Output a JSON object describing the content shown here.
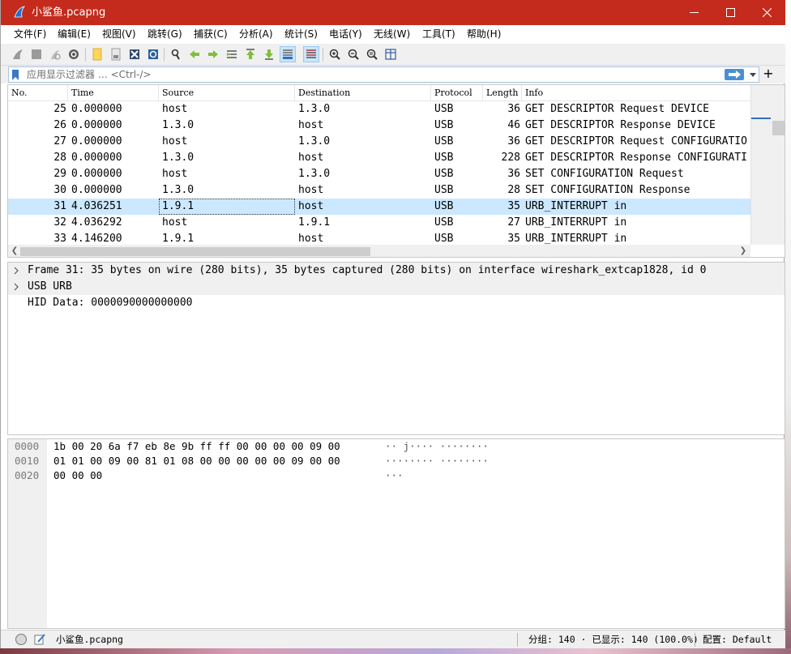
{
  "window": {
    "title": "小鲨鱼.pcapng"
  },
  "menu": [
    {
      "label": "文件(F)"
    },
    {
      "label": "编辑(E)"
    },
    {
      "label": "视图(V)"
    },
    {
      "label": "跳转(G)"
    },
    {
      "label": "捕获(C)"
    },
    {
      "label": "分析(A)"
    },
    {
      "label": "统计(S)"
    },
    {
      "label": "电话(Y)"
    },
    {
      "label": "无线(W)"
    },
    {
      "label": "工具(T)"
    },
    {
      "label": "帮助(H)"
    }
  ],
  "toolbar": {
    "icons": [
      "shark-fin-start-icon",
      "stop-square-icon",
      "restart-fin-icon",
      "capture-options-gear-icon",
      "open-folder-icon",
      "save-file-icon",
      "close-file-icon",
      "reload-file-icon",
      "find-packet-icon",
      "go-back-icon",
      "go-forward-icon",
      "go-to-packet-icon",
      "go-first-icon",
      "go-last-icon",
      "autoscroll-icon",
      "colorize-icon",
      "zoom-in-icon",
      "zoom-out-icon",
      "zoom-normal-icon",
      "resize-columns-icon"
    ]
  },
  "filter": {
    "placeholder": "应用显示过滤器 … <Ctrl-/>",
    "plus": "+"
  },
  "packet_list": {
    "columns": [
      "No.",
      "Time",
      "Source",
      "Destination",
      "Protocol",
      "Length",
      "Info"
    ],
    "rows": [
      {
        "no": "25",
        "time": "0.000000",
        "source": "host",
        "destination": "1.3.0",
        "protocol": "USB",
        "length": "36",
        "info": "GET DESCRIPTOR Request DEVICE"
      },
      {
        "no": "26",
        "time": "0.000000",
        "source": "1.3.0",
        "destination": "host",
        "protocol": "USB",
        "length": "46",
        "info": "GET DESCRIPTOR Response DEVICE"
      },
      {
        "no": "27",
        "time": "0.000000",
        "source": "host",
        "destination": "1.3.0",
        "protocol": "USB",
        "length": "36",
        "info": "GET DESCRIPTOR Request CONFIGURATIO"
      },
      {
        "no": "28",
        "time": "0.000000",
        "source": "1.3.0",
        "destination": "host",
        "protocol": "USB",
        "length": "228",
        "info": "GET DESCRIPTOR Response CONFIGURATI"
      },
      {
        "no": "29",
        "time": "0.000000",
        "source": "host",
        "destination": "1.3.0",
        "protocol": "USB",
        "length": "36",
        "info": "SET CONFIGURATION Request"
      },
      {
        "no": "30",
        "time": "0.000000",
        "source": "1.3.0",
        "destination": "host",
        "protocol": "USB",
        "length": "28",
        "info": "SET CONFIGURATION Response"
      },
      {
        "no": "31",
        "time": "4.036251",
        "source": "1.9.1",
        "destination": "host",
        "protocol": "USB",
        "length": "35",
        "info": "URB_INTERRUPT in"
      },
      {
        "no": "32",
        "time": "4.036292",
        "source": "host",
        "destination": "1.9.1",
        "protocol": "USB",
        "length": "27",
        "info": "URB_INTERRUPT in"
      },
      {
        "no": "33",
        "time": "4.146200",
        "source": "1.9.1",
        "destination": "host",
        "protocol": "USB",
        "length": "35",
        "info": "URB_INTERRUPT in"
      }
    ]
  },
  "details": [
    {
      "text": "Frame 31: 35 bytes on wire (280 bits), 35 bytes captured (280 bits) on interface wireshark_extcap1828, id 0",
      "expandable": true
    },
    {
      "text": "USB URB",
      "expandable": true
    },
    {
      "text": "HID Data: 0000090000000000",
      "expandable": false
    }
  ],
  "bytes": [
    {
      "offset": "0000",
      "hex": "1b 00 20 6a f7 eb 8e 9b  ff ff 00 00 00 00 09 00",
      "ascii": "·· j···· ········"
    },
    {
      "offset": "0010",
      "hex": "01 01 00 09 00 81 01 08  00 00 00 00 00 09 00 00",
      "ascii": "········ ········"
    },
    {
      "offset": "0020",
      "hex": "00 00 00",
      "ascii": "···"
    }
  ],
  "status": {
    "file": "小鲨鱼.pcapng",
    "packets": "分组: 140 · 已显示: 140 (100.0%)",
    "profile": "配置: Default"
  }
}
